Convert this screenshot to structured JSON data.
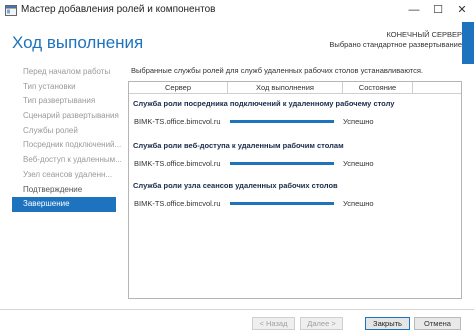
{
  "window": {
    "title": "Мастер добавления ролей и компонентов",
    "minimize": "—",
    "maximize": "☐",
    "close": "✕"
  },
  "header": {
    "title": "Ход выполнения",
    "server_line1": "КОНЕЧНЫЙ СЕРВЕР",
    "server_line2": "Выбрано стандартное развертывание"
  },
  "nav": {
    "items": [
      {
        "label": "Перед началом работы",
        "state": "disabled"
      },
      {
        "label": "Тип установки",
        "state": "disabled"
      },
      {
        "label": "Тип развертывания",
        "state": "disabled"
      },
      {
        "label": "Сценарий развертывания",
        "state": "disabled"
      },
      {
        "label": "Службы ролей",
        "state": "disabled"
      },
      {
        "label": "Посредник подключений...",
        "state": "disabled"
      },
      {
        "label": "Веб-доступ к удаленным...",
        "state": "disabled"
      },
      {
        "label": "Узел сеансов удаленн...",
        "state": "disabled"
      },
      {
        "label": "Подтверждение",
        "state": "done"
      },
      {
        "label": "Завершение",
        "state": "active"
      }
    ]
  },
  "main": {
    "intro": "Выбранные службы ролей для служб удаленных рабочих столов устанавливаются.",
    "columns": {
      "server": "Сервер",
      "progress": "Ход выполнения",
      "status": "Состояние"
    },
    "groups": [
      {
        "title": "Служба роли посредника подключений к удаленному рабочему столу",
        "server": "BIMK-TS.office.bimcvol.ru",
        "progress": 1.0,
        "status": "Успешно"
      },
      {
        "title": "Служба роли веб-доступа к удаленным рабочим столам",
        "server": "BIMK-TS.office.bimcvol.ru",
        "progress": 1.0,
        "status": "Успешно"
      },
      {
        "title": "Служба роли узла сеансов удаленных рабочих столов",
        "server": "BIMK-TS.office.bimcvol.ru",
        "progress": 1.0,
        "status": "Успешно"
      }
    ]
  },
  "footer": {
    "back": "< Назад",
    "next": "Далее >",
    "close": "Закрыть",
    "cancel": "Отмена"
  },
  "colors": {
    "accent": "#1e73be"
  }
}
